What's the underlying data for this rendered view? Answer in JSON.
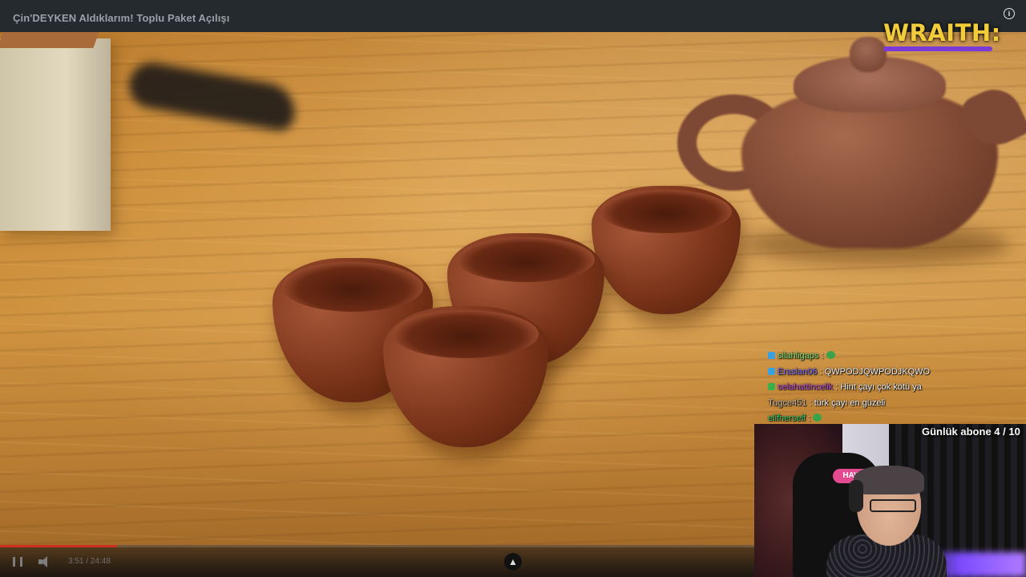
{
  "header": {
    "video_title": "Çin'DEYKEN Aldıklarım! Toplu Paket Açılışı",
    "info_icon": "info-icon"
  },
  "sponsor": {
    "logo_text": "WRAITH:",
    "logo_color": "#f2cc3a",
    "bar_color": "#7a3ad8"
  },
  "chat": {
    "messages": [
      {
        "user": "silahligaps",
        "sep": " :",
        "text": "",
        "user_color": "#7fe07a",
        "badge_color": "#3aa0e0",
        "emote": true
      },
      {
        "user": "Eraslan06",
        "sep": " :",
        "text": " QWPODJQWPODJKQWO",
        "user_color": "#7d6bff",
        "badge_color": "#3aa0e0",
        "emote": false
      },
      {
        "user": "selahattincelik",
        "sep": " :",
        "text": " Hint çayı çok kötü ya",
        "user_color": "#b64fd8",
        "badge_color": "#3ab04a",
        "emote": false
      },
      {
        "user": "Tugce451",
        "sep": " :",
        "text": " türk çayı en güzeli",
        "user_color": "#c9b7a6",
        "badge_color": "",
        "emote": false
      },
      {
        "user": "elifherself",
        "sep": " :",
        "text": "",
        "user_color": "#3ac46a",
        "badge_color": "",
        "emote": true
      }
    ]
  },
  "overlay": {
    "sub_goal": "Günlük abone 4 / 10",
    "chair_brand": "HAW"
  },
  "player": {
    "time": "3:51 / 24:48",
    "progress": 0.155,
    "expand_symbol": "▲",
    "pause_icon": "pause-icon",
    "volume_icon": "volume-icon"
  }
}
